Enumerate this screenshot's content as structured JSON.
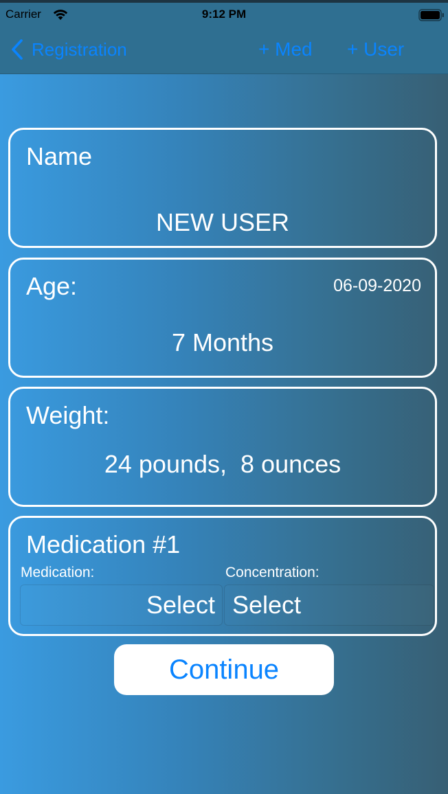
{
  "status_bar": {
    "carrier": "Carrier",
    "time": "9:12 PM",
    "wifi_icon": "wifi-icon",
    "battery_icon": "battery-icon"
  },
  "nav": {
    "back_label": "Registration",
    "add_med_label": "+ Med",
    "add_user_label": "+ User",
    "accent_color": "#0a84ff"
  },
  "name_card": {
    "label": "Name",
    "value": "NEW USER"
  },
  "age_card": {
    "label": "Age:",
    "date": "06-09-2020",
    "value": "7 Months"
  },
  "weight_card": {
    "label": "Weight:",
    "value": "24 pounds,  8 ounces"
  },
  "medication_card": {
    "title": "Medication #1",
    "medication_label": "Medication:",
    "medication_value": "Select",
    "concentration_label": "Concentration:",
    "concentration_value": "Select"
  },
  "continue_label": "Continue"
}
